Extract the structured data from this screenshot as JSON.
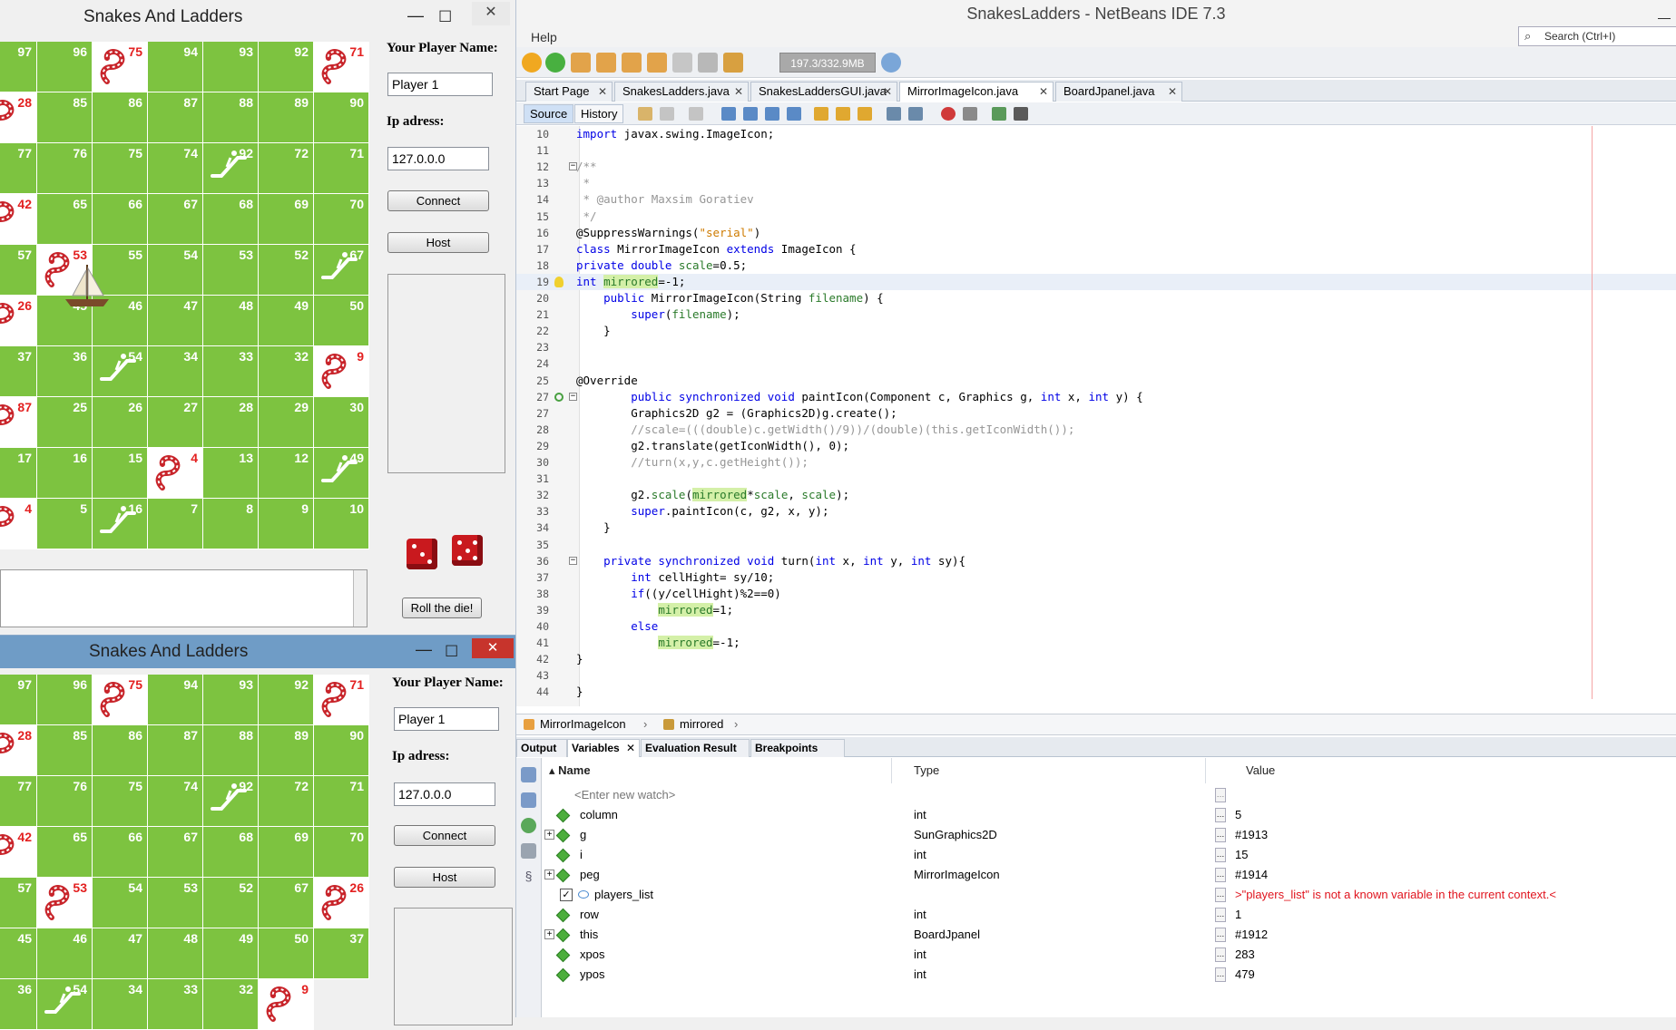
{
  "ide": {
    "title": "SnakesLadders - NetBeans IDE 7.3",
    "menu": "Help",
    "memory": "197.3/332.9MB",
    "search_placeholder": "Search (Ctrl+I)",
    "tabs": [
      "Start Page",
      "SnakesLadders.java",
      "SnakesLaddersGUI.java",
      "MirrorImageIcon.java",
      "BoardJpanel.java"
    ],
    "active_tab": "MirrorImageIcon.java",
    "editor_tabs": {
      "source": "Source",
      "history": "History"
    },
    "breadcrumb": {
      "class": "MirrorImageIcon",
      "member": "mirrored"
    },
    "code": [
      {
        "n": "10",
        "t": "import javax.swing.ImageIcon;"
      },
      {
        "n": "11",
        "t": ""
      },
      {
        "n": "12",
        "t": "/**"
      },
      {
        "n": "13",
        "t": " *"
      },
      {
        "n": "14",
        "t": " * @author Maxsim Goratiev"
      },
      {
        "n": "15",
        "t": " */"
      },
      {
        "n": "16",
        "t": "@SuppressWarnings(\"serial\")"
      },
      {
        "n": "17",
        "t": "class MirrorImageIcon extends ImageIcon {"
      },
      {
        "n": "18",
        "t": "private double scale=0.5;"
      },
      {
        "n": "19",
        "t": "int mirrored=-1;"
      },
      {
        "n": "20",
        "t": "    public MirrorImageIcon(String filename) {"
      },
      {
        "n": "21",
        "t": "        super(filename);"
      },
      {
        "n": "22",
        "t": "    }"
      },
      {
        "n": "23",
        "t": ""
      },
      {
        "n": "24",
        "t": ""
      },
      {
        "n": "25",
        "t": "@Override"
      },
      {
        "n": "27",
        "t": "        public synchronized void paintIcon(Component c, Graphics g, int x, int y) {"
      },
      {
        "n": "27",
        "t": "        Graphics2D g2 = (Graphics2D)g.create();"
      },
      {
        "n": "28",
        "t": "        //scale=(((double)c.getWidth()/9))/(double)(this.getIconWidth());"
      },
      {
        "n": "29",
        "t": "        g2.translate(getIconWidth(), 0);"
      },
      {
        "n": "30",
        "t": "        //turn(x,y,c.getHeight());"
      },
      {
        "n": "31",
        "t": ""
      },
      {
        "n": "32",
        "t": "        g2.scale(mirrored*scale, scale);"
      },
      {
        "n": "33",
        "t": "        super.paintIcon(c, g2, x, y);"
      },
      {
        "n": "34",
        "t": "    }"
      },
      {
        "n": "35",
        "t": ""
      },
      {
        "n": "36",
        "t": "    private synchronized void turn(int x, int y, int sy){"
      },
      {
        "n": "37",
        "t": "        int cellHight= sy/10;"
      },
      {
        "n": "38",
        "t": "        if((y/cellHight)%2==0)"
      },
      {
        "n": "39",
        "t": "            mirrored=1;"
      },
      {
        "n": "40",
        "t": "        else"
      },
      {
        "n": "41",
        "t": "            mirrored=-1;"
      },
      {
        "n": "42",
        "t": "}"
      },
      {
        "n": "43",
        "t": ""
      },
      {
        "n": "44",
        "t": "}"
      }
    ],
    "debug_tabs": [
      "Output",
      "Variables",
      "Evaluation Result",
      "Breakpoints"
    ],
    "vars_headers": {
      "name": "Name",
      "type": "Type",
      "value": "Value"
    },
    "watch_placeholder": "<Enter new watch>",
    "variables": [
      {
        "name": "column",
        "type": "int",
        "value": "5",
        "expand": false
      },
      {
        "name": "g",
        "type": "SunGraphics2D",
        "value": "#1913",
        "expand": true
      },
      {
        "name": "i",
        "type": "int",
        "value": "15",
        "expand": false
      },
      {
        "name": "peg",
        "type": "MirrorImageIcon",
        "value": "#1914",
        "expand": true
      },
      {
        "name": "players_list",
        "type": "",
        "value": ">\"players_list\" is not a known variable in the current context.<",
        "expand": false,
        "error": true
      },
      {
        "name": "row",
        "type": "int",
        "value": "1",
        "expand": false
      },
      {
        "name": "this",
        "type": "BoardJpanel",
        "value": "#1912",
        "expand": true
      },
      {
        "name": "xpos",
        "type": "int",
        "value": "283",
        "expand": false
      },
      {
        "name": "ypos",
        "type": "int",
        "value": "479",
        "expand": false
      }
    ],
    "colors": {
      "keyword": "#0000e6",
      "comment": "#969696",
      "string": "#ce7b00",
      "highlight": "#d4f0a8",
      "error": "#e0141e"
    }
  },
  "game1": {
    "title": "Snakes And Ladders",
    "player_name_label": "Your Player Name:",
    "player_name": "Player 1",
    "ip_label": "Ip adress:",
    "ip": "127.0.0.0",
    "connect": "Connect",
    "host": "Host",
    "roll": "Roll the die!",
    "rows": [
      [
        "97",
        "96",
        "75",
        "94",
        "93",
        "92",
        "71"
      ],
      [
        "28",
        "85",
        "86",
        "87",
        "88",
        "89",
        "90"
      ],
      [
        "77",
        "76",
        "75",
        "74",
        "92",
        "72",
        "71"
      ],
      [
        "42",
        "65",
        "66",
        "67",
        "68",
        "69",
        "70"
      ],
      [
        "57",
        "53",
        "55",
        "54",
        "53",
        "52",
        "67"
      ],
      [
        "26",
        "45",
        "46",
        "47",
        "48",
        "49",
        "50"
      ],
      [
        "37",
        "36",
        "54",
        "34",
        "33",
        "32",
        "9"
      ],
      [
        "87",
        "25",
        "26",
        "27",
        "28",
        "29",
        "30"
      ],
      [
        "17",
        "16",
        "15",
        "4",
        "13",
        "12",
        "49"
      ],
      [
        "4",
        "5",
        "16",
        "7",
        "8",
        "9",
        "10"
      ]
    ]
  },
  "game2": {
    "title": "Snakes And Ladders",
    "player_name_label": "Your Player Name:",
    "player_name": "Player 1",
    "ip_label": "Ip adress:",
    "ip": "127.0.0.0",
    "connect": "Connect",
    "host": "Host",
    "rows": [
      [
        "97",
        "96",
        "75",
        "94",
        "93",
        "92",
        "71"
      ],
      [
        "28",
        "85",
        "86",
        "87",
        "88",
        "89",
        "90"
      ],
      [
        "77",
        "76",
        "75",
        "74",
        "92",
        "72",
        "71"
      ],
      [
        "42",
        "65",
        "66",
        "67",
        "68",
        "69",
        "70"
      ],
      [
        "57",
        "53",
        "54",
        "53",
        "52",
        "67"
      ],
      [
        "26",
        "45",
        "46",
        "47",
        "48",
        "49",
        "50"
      ],
      [
        "37",
        "36",
        "54",
        "34",
        "33",
        "32",
        "9"
      ]
    ]
  }
}
